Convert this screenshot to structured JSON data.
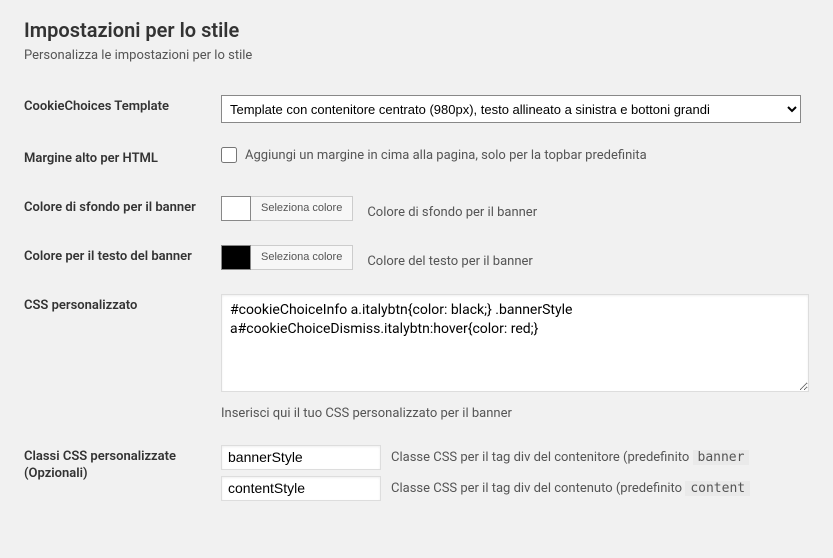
{
  "header": {
    "title": "Impostazioni per lo stile",
    "subtitle": "Personalizza le impostazioni per lo stile"
  },
  "fields": {
    "template": {
      "label": "CookieChoices Template",
      "selected": "Template con contenitore centrato (980px), testo allineato a sinistra e bottoni grandi"
    },
    "margin": {
      "label": "Margine alto per HTML",
      "checkbox_label": "Aggiungi un margine in cima alla pagina, solo per la topbar predefinita"
    },
    "bg_color": {
      "label": "Colore di sfondo per il banner",
      "button": "Seleziona colore",
      "desc": "Colore di sfondo per il banner",
      "value": "#ffffff"
    },
    "text_color": {
      "label": "Colore per il testo del banner",
      "button": "Seleziona colore",
      "desc": "Colore del testo per il banner",
      "value": "#000000"
    },
    "custom_css": {
      "label": "CSS personalizzato",
      "value": "#cookieChoiceInfo a.italybtn{color: black;} .bannerStyle a#cookieChoiceDismiss.italybtn:hover{color: red;}",
      "help": "Inserisci qui il tuo CSS personalizzato per il banner"
    },
    "classes": {
      "label": "Classi CSS personalizzate (Opzionali)",
      "banner": {
        "value": "bannerStyle",
        "desc_prefix": "Classe CSS per il tag div del contenitore (predefinito ",
        "code": "banner"
      },
      "content": {
        "value": "contentStyle",
        "desc_prefix": "Classe CSS per il tag div del contenuto (predefinito ",
        "code": "content"
      }
    }
  }
}
